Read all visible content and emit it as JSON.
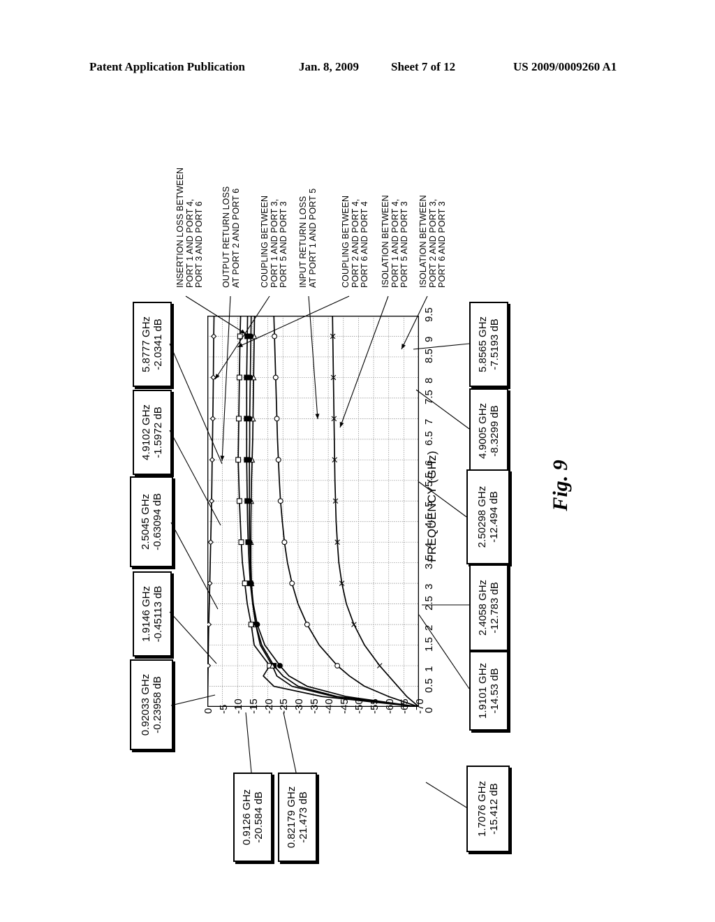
{
  "header": {
    "publication": "Patent Application Publication",
    "date": "Jan. 8, 2009",
    "sheet": "Sheet 7 of 12",
    "number": "US 2009/0009260 A1"
  },
  "figure": {
    "caption": "Fig. 9"
  },
  "chart_data": {
    "type": "line",
    "title": "",
    "xlabel": "FREQUENCY (GHz)",
    "ylabel": "",
    "xlim": [
      0,
      9.5
    ],
    "ylim": [
      -70,
      0
    ],
    "grid": true,
    "legend": "none",
    "orientation": "rotated-90",
    "xticks": [
      "0",
      "0.5",
      "1",
      "1.5",
      "2",
      "2.5",
      "3",
      "3.5",
      "4",
      "4.5",
      "5",
      "5.5",
      "6",
      "6.5",
      "7",
      "7.5",
      "8",
      "8.5",
      "9",
      "9.5"
    ],
    "yticks": [
      "0",
      "-5",
      "-10",
      "-15",
      "-20",
      "-25",
      "-30",
      "-35",
      "-40",
      "-45",
      "-50",
      "-55",
      "-60",
      "-65",
      "-70"
    ],
    "x": [
      0,
      0.25,
      0.5,
      0.75,
      1,
      1.5,
      2,
      2.5,
      3,
      3.5,
      4,
      4.5,
      5,
      5.5,
      6,
      6.5,
      7,
      7.5,
      8,
      8.5,
      9,
      9.5
    ],
    "series": [
      {
        "name": "INSERTION LOSS BETWEEN PORT 1 AND PORT 4, PORT 3 AND PORT 6",
        "marker": "diamond-open",
        "values": [
          0,
          -0.08,
          -0.16,
          -0.2,
          -0.25,
          -0.33,
          -0.45,
          -0.63,
          -0.8,
          -0.95,
          -1.1,
          -1.25,
          -1.4,
          -1.5,
          -1.58,
          -1.7,
          -1.8,
          -1.9,
          -1.98,
          -2.03,
          -2.1,
          -2.2
        ]
      },
      {
        "name": "OUTPUT RETURN LOSS AT PORT 2 AND PORT 6",
        "marker": "square-open",
        "values": [
          -70,
          -38,
          -22,
          -18.5,
          -20.6,
          -15.5,
          -14.5,
          -13.2,
          -12.4,
          -11.6,
          -11.2,
          -10.9,
          -10.6,
          -10.4,
          -10.2,
          -10.3,
          -10.4,
          -10.5,
          -10.6,
          -10.7,
          -10.8,
          -11.0
        ]
      },
      {
        "name": "COUPLING BETWEEN PORT 1 AND PORT 3, PORT 5 AND PORT 3",
        "marker": "square-filled",
        "values": [
          -70,
          -43,
          -30,
          -25,
          -22,
          -18,
          -16,
          -15,
          -14.2,
          -13.8,
          -13.5,
          -13.3,
          -13.2,
          -13.1,
          -13.0,
          -13.0,
          -13.0,
          -13.0,
          -13.0,
          -13.1,
          -13.2,
          -13.3
        ]
      },
      {
        "name": "INPUT RETURN LOSS AT PORT 1 AND PORT 5",
        "marker": "triangle-open",
        "values": [
          -70,
          -42,
          -28,
          -23,
          -21.5,
          -17.5,
          -16,
          -15,
          -14.6,
          -14.4,
          -14.4,
          -14.4,
          -14.5,
          -14.6,
          -14.8,
          -15.0,
          -15.1,
          -15.2,
          -15.3,
          -15.4,
          -15.5,
          -15.6
        ]
      },
      {
        "name": "COUPLING BETWEEN PORT 2 AND PORT 4, PORT 6 AND PORT 4",
        "marker": "circle-filled",
        "values": [
          -70,
          -46,
          -33,
          -27,
          -24,
          -19,
          -16.5,
          -15.2,
          -14.5,
          -14.2,
          -14.0,
          -13.9,
          -13.9,
          -13.9,
          -13.9,
          -14.0,
          -14.0,
          -14.1,
          -14.2,
          -14.3,
          -14.4,
          -14.5
        ]
      },
      {
        "name": "ISOLATION BETWEEN PORT 1 AND PORT 4, PORT 5 AND PORT 3",
        "marker": "circle-open",
        "values": [
          -70,
          -60,
          -52,
          -47,
          -43,
          -37,
          -33,
          -30,
          -28,
          -26.5,
          -25.5,
          -24.8,
          -24.2,
          -23.8,
          -23.5,
          -23.2,
          -23.0,
          -22.8,
          -22.6,
          -22.4,
          -22.2,
          -22.0
        ]
      },
      {
        "name": "ISOLATION BETWEEN PORT 2 AND PORT 3, PORT 6 AND PORT 3",
        "marker": "x-mark",
        "values": [
          -70,
          -66,
          -63,
          -60,
          -57,
          -52,
          -48.5,
          -46,
          -44.5,
          -43.5,
          -43,
          -42.6,
          -42.4,
          -42.2,
          -42.1,
          -42,
          -41.9,
          -41.8,
          -41.7,
          -41.6,
          -41.5,
          -41.4
        ]
      }
    ],
    "markers_left": [
      {
        "freq": "5.8777 GHz",
        "level": "-2.0341 dB"
      },
      {
        "freq": "4.9102 GHz",
        "level": "-1.5972 dB"
      },
      {
        "freq": "2.5045 GHz",
        "level": "-0.63094 dB"
      },
      {
        "freq": "1.9146 GHz",
        "level": "-0.45113 dB"
      },
      {
        "freq": "0.92033 GHz",
        "level": "-0.23958 dB"
      }
    ],
    "markers_right": [
      {
        "freq": "5.8565 GHz",
        "level": "-7.5193 dB"
      },
      {
        "freq": "4.9005 GHz",
        "level": "-8.3299 dB"
      },
      {
        "freq": "2.50298 GHz",
        "level": "-12.494 dB"
      },
      {
        "freq": "2.4058 GHz",
        "level": "-12.783 dB"
      },
      {
        "freq": "1.9101 GHz",
        "level": "-14.53 dB"
      },
      {
        "freq": "1.7076 GHz",
        "level": "-15.412 dB"
      }
    ],
    "markers_bottom": [
      {
        "freq": "0.9126 GHz",
        "level": "-20.584 dB"
      },
      {
        "freq": "0.82179 GHz",
        "level": "-21.473 dB"
      }
    ]
  },
  "curve_labels": [
    {
      "lines": [
        "INSERTION LOSS BETWEEN",
        "PORT 1 AND PORT 4,",
        "PORT 3 AND PORT 6"
      ]
    },
    {
      "lines": [
        "OUTPUT RETURN LOSS",
        "AT PORT 2 AND PORT 6"
      ]
    },
    {
      "lines": [
        "COUPLING BETWEEN",
        "PORT 1 AND PORT 3,",
        "PORT 5 AND PORT 3"
      ]
    },
    {
      "lines": [
        "INPUT RETURN LOSS",
        "AT PORT 1 AND PORT 5"
      ]
    },
    {
      "lines": [
        "COUPLING BETWEEN",
        "PORT 2 AND PORT 4,",
        "PORT 6 AND PORT 4"
      ]
    },
    {
      "lines": [
        "ISOLATION BETWEEN",
        "PORT 1 AND PORT 4,",
        "PORT 5 AND PORT 3"
      ]
    },
    {
      "lines": [
        "ISOLATION BETWEEN",
        "PORT 2 AND PORT 3,",
        "PORT 6 AND PORT 3"
      ]
    }
  ]
}
